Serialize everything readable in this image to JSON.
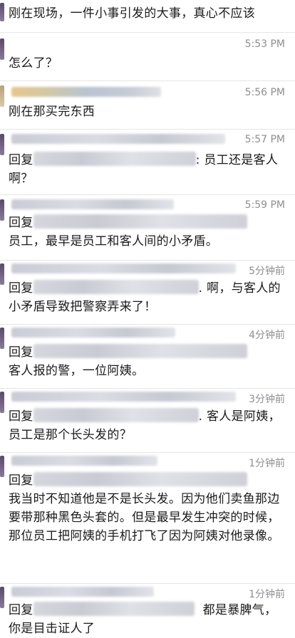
{
  "messages": [
    {
      "time": "",
      "text": "刚在现场，一件小事引发的大事，真心不应该"
    },
    {
      "time": "5:53 PM",
      "text": "怎么了？"
    },
    {
      "time": "5:56 PM",
      "text": "刚在那买完东西"
    },
    {
      "time": "5:57 PM",
      "prefix": "回复",
      "text": ": 员工还是客人啊？"
    },
    {
      "time": "5:59 PM",
      "prefix": "回复",
      "text": "员工，最早是员工和客人间的小矛盾。"
    },
    {
      "time": "5分钟前",
      "prefix": "回复",
      "text": ". 啊，与客人的小矛盾导致把警察弄来了！"
    },
    {
      "time": "4分钟前",
      "prefix": "回复",
      "text": "客人报的警，一位阿姨。"
    },
    {
      "time": "3分钟前",
      "prefix": "回复",
      "text": ". 客人是阿姨，员工是那个长头发的？"
    },
    {
      "time": "1分钟前",
      "prefix": "回复",
      "text": "我当时不知道他是不是长头发。因为他们卖鱼那边要带那种黑色头套的。但是最早发生冲突的时候，那位员工把阿姨的手机打飞了因为阿姨对他录像。"
    },
    {
      "time": "1分钟前",
      "prefix": "回复",
      "text": "都是暴脾气，你是目击证人了"
    }
  ]
}
